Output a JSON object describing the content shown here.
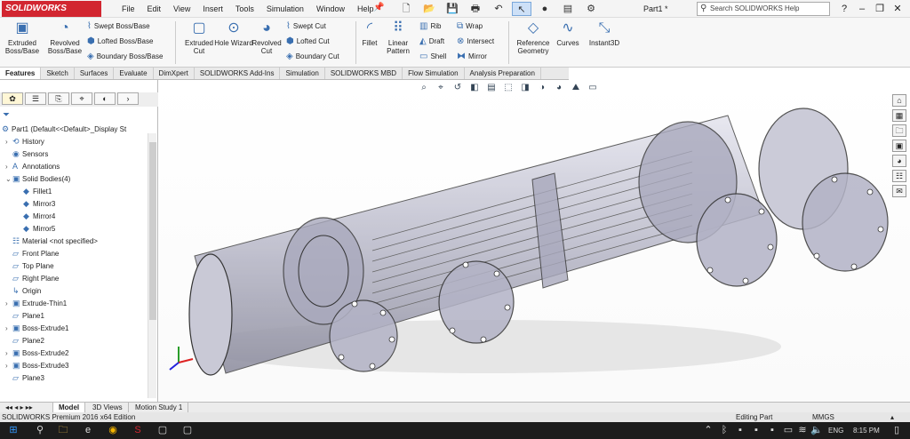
{
  "app": {
    "logo": "SOLIDWORKS",
    "doc_title": "Part1 *",
    "search_placeholder": "Search SOLIDWORKS Help"
  },
  "menus": [
    "File",
    "Edit",
    "View",
    "Insert",
    "Tools",
    "Simulation",
    "Window",
    "Help"
  ],
  "ribbon": {
    "extruded_boss": "Extruded Boss/Base",
    "revolved_boss": "Revolved Boss/Base",
    "swept_boss": "Swept Boss/Base",
    "lofted_boss": "Lofted Boss/Base",
    "boundary_boss": "Boundary Boss/Base",
    "extruded_cut": "Extruded Cut",
    "hole_wizard": "Hole Wizard",
    "revolved_cut": "Revolved Cut",
    "swept_cut": "Swept Cut",
    "lofted_cut": "Lofted Cut",
    "boundary_cut": "Boundary Cut",
    "fillet": "Fillet",
    "linear_pattern": "Linear Pattern",
    "rib": "Rib",
    "draft": "Draft",
    "shell": "Shell",
    "wrap": "Wrap",
    "intersect": "Intersect",
    "mirror": "Mirror",
    "reference_geometry": "Reference Geometry",
    "curves": "Curves",
    "instant3d": "Instant3D"
  },
  "tabs": [
    "Features",
    "Sketch",
    "Surfaces",
    "Evaluate",
    "DimXpert",
    "SOLIDWORKS Add-Ins",
    "Simulation",
    "SOLIDWORKS MBD",
    "Flow Simulation",
    "Analysis Preparation"
  ],
  "tree": {
    "root": "Part1  (Default<<Default>_Display St",
    "items": [
      "History",
      "Sensors",
      "Annotations",
      "Solid Bodies(4)",
      "Fillet1",
      "Mirror3",
      "Mirror4",
      "Mirror5",
      "Material <not specified>",
      "Front Plane",
      "Top Plane",
      "Right Plane",
      "Origin",
      "Extrude-Thin1",
      "Plane1",
      "Boss-Extrude1",
      "Plane2",
      "Boss-Extrude2",
      "Boss-Extrude3",
      "Plane3"
    ]
  },
  "bottom_tabs": [
    "Model",
    "3D Views",
    "Motion Study 1"
  ],
  "status": {
    "edition": "SOLIDWORKS Premium 2016 x64 Edition",
    "mode": "Editing Part",
    "units": "MMGS"
  },
  "taskbar": {
    "lang": "ENG",
    "time": "8:15 PM"
  }
}
